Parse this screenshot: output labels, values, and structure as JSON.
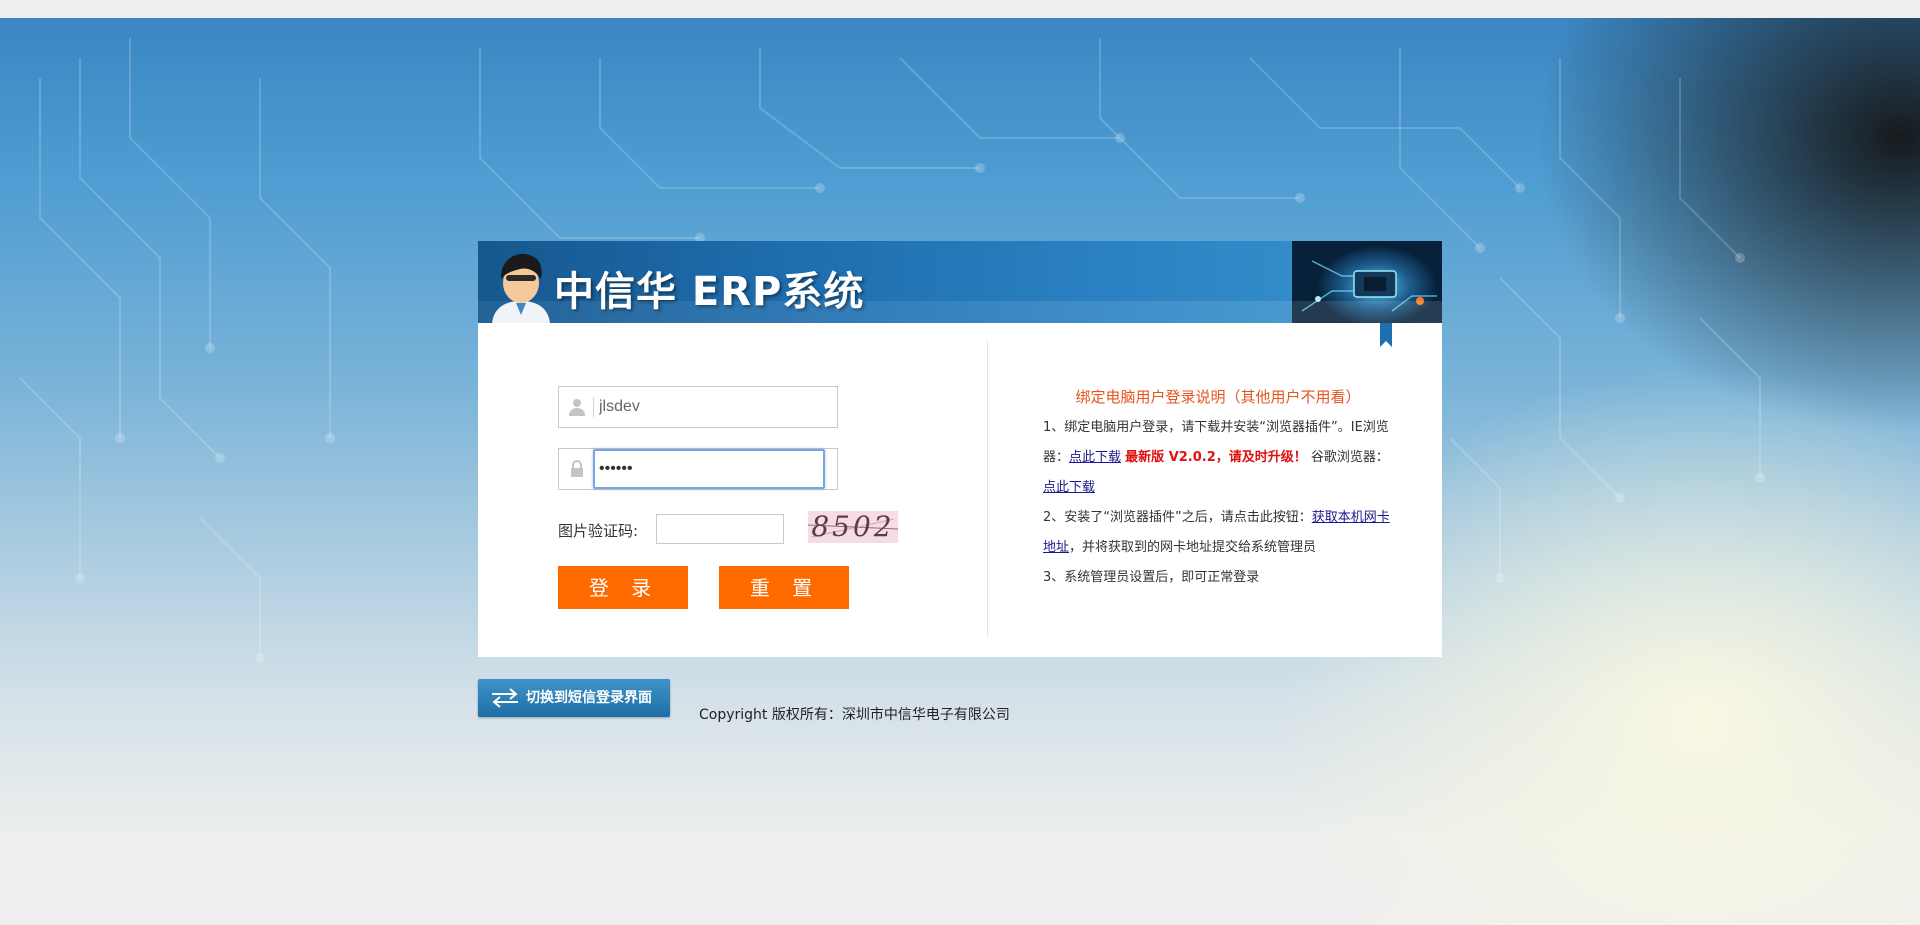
{
  "header": {
    "title": "中信华 ERP系统"
  },
  "login_form": {
    "username_value": "jlsdev",
    "password_value": "••••••",
    "captcha_label": "图片验证码:",
    "captcha_input_value": "",
    "captcha_image_text": "8502",
    "login_button_label": "登 录",
    "reset_button_label": "重 置"
  },
  "instructions": {
    "title": "绑定电脑用户登录说明（其他用户不用看）",
    "step1_text_a": "1、绑定电脑用户登录，请下载并安装“浏览器插件”。IE浏览器：",
    "step1_ie_link": "点此下载",
    "step1_version_notice": "最新版 V2.0.2，请及时升级！",
    "step1_chrome_text": "谷歌浏览器：",
    "step1_chrome_link": "点此下载",
    "step2_text_a": "2、安装了“浏览器插件”之后，请点击此按钮：",
    "step2_link": "获取本机网卡地址",
    "step2_text_b": "，并将获取到的网卡地址提交给系统管理员",
    "step3_text": "3、系统管理员设置后，即可正常登录"
  },
  "footer": {
    "switch_button_label": "切换到短信登录界面",
    "copyright": "Copyright 版权所有：深圳市中信华电子有限公司"
  },
  "colors": {
    "accent_orange": "#ff6a00",
    "header_blue": "#1f6fb0",
    "notice_red": "#e01010",
    "instruction_title": "#e8541e"
  },
  "icons": {
    "username": "user-icon",
    "password": "lock-icon",
    "switch": "swap-arrows-icon"
  }
}
